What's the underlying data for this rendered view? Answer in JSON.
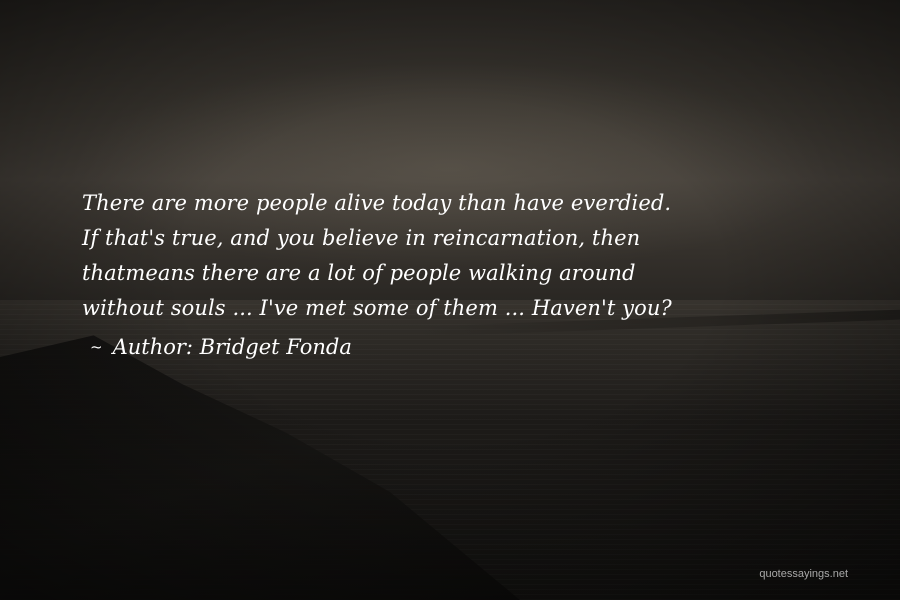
{
  "quote": {
    "lines": [
      "There are more people alive today than have everdied.",
      "If that's true, and you believe in reincarnation, then",
      "thatmeans there are a lot of people walking around",
      "without souls ... I've met some of them ... Haven't you?"
    ]
  },
  "attribution": {
    "marker": "~",
    "author_label": "Author: Bridget Fonda"
  },
  "watermark": "quotessayings.net"
}
